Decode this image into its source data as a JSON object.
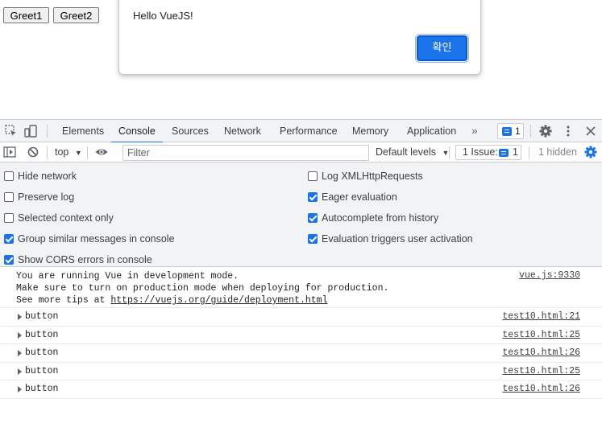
{
  "page": {
    "greet1_label": "Greet1",
    "greet2_label": "Greet2"
  },
  "alert": {
    "message": "Hello VueJS!",
    "ok_label": "확인"
  },
  "devtools": {
    "tabs": [
      "Elements",
      "Console",
      "Sources",
      "Network",
      "Performance",
      "Memory",
      "Application"
    ],
    "active_tab": "Console",
    "more_tabs": "»",
    "issues_badge_count": "1",
    "context": "top",
    "filter_placeholder": "Filter",
    "default_levels": "Default levels",
    "issue_count_label": "1 Issue:",
    "issue_count_num": "1",
    "hidden_count": "1 hidden",
    "settings": {
      "left": [
        {
          "label": "Hide network",
          "checked": false
        },
        {
          "label": "Preserve log",
          "checked": false
        },
        {
          "label": "Selected context only",
          "checked": false
        },
        {
          "label": "Group similar messages in console",
          "checked": true
        },
        {
          "label": "Show CORS errors in console",
          "checked": true
        }
      ],
      "right": [
        {
          "label": "Log XMLHttpRequests",
          "checked": false
        },
        {
          "label": "Eager evaluation",
          "checked": true
        },
        {
          "label": "Autocomplete from history",
          "checked": true
        },
        {
          "label": "Evaluation triggers user activation",
          "checked": true
        }
      ]
    },
    "console": {
      "vue_message": {
        "line1": "You are running Vue in development mode.",
        "line2": "Make sure to turn on production mode when deploying for production.",
        "line3_prefix": "See more tips at ",
        "line3_link": "https://vuejs.org/guide/deployment.html",
        "source": "vue.js:9330"
      },
      "entries": [
        {
          "text": "button",
          "source": "test10.html:21"
        },
        {
          "text": "button",
          "source": "test10.html:25"
        },
        {
          "text": "button",
          "source": "test10.html:26"
        },
        {
          "text": "button",
          "source": "test10.html:25"
        },
        {
          "text": "button",
          "source": "test10.html:26"
        }
      ]
    }
  },
  "colors": {
    "accent": "#1a73e8",
    "toolbar_bg": "#f1f3f4"
  }
}
